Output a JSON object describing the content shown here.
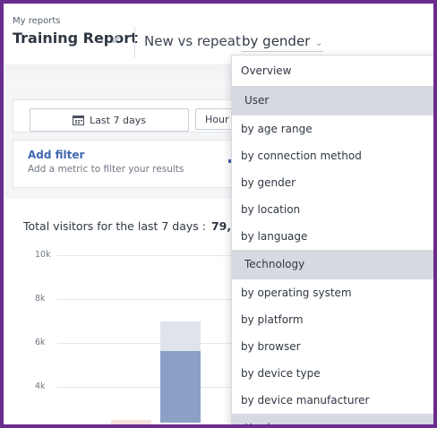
{
  "header": {
    "breadcrumb": "My reports",
    "title": "Training Report",
    "subtitle": "New vs repeat",
    "selector_value": "by gender",
    "selector_chevron": "⌄"
  },
  "controls": {
    "date_label": "Last 7 days",
    "interval_label": "Hour"
  },
  "filter": {
    "title": "Add filter",
    "description": "Add a metric to filter your results"
  },
  "chart_data": {
    "type": "bar",
    "title": "Total visitors for the last 7 days :",
    "total_prefix": "79,",
    "yticks": [
      "10k",
      "8k",
      "6k",
      "4k"
    ],
    "ylim": [
      2000,
      10000
    ],
    "series": [
      {
        "values": [
          7000
        ],
        "color": "#dfe4ec"
      },
      {
        "values": [
          5650
        ],
        "color": "#8aa1c5"
      }
    ],
    "partial_bar_color": "#f8e1dc"
  },
  "dropdown": {
    "items": [
      {
        "kind": "item",
        "label": "Overview"
      },
      {
        "kind": "group",
        "label": "User"
      },
      {
        "kind": "item",
        "label": "by age range"
      },
      {
        "kind": "item",
        "label": "by connection method"
      },
      {
        "kind": "item",
        "label": "by gender"
      },
      {
        "kind": "item",
        "label": "by location"
      },
      {
        "kind": "item",
        "label": "by language"
      },
      {
        "kind": "group",
        "label": "Technology"
      },
      {
        "kind": "item",
        "label": "by operating system"
      },
      {
        "kind": "item",
        "label": "by platform"
      },
      {
        "kind": "item",
        "label": "by browser"
      },
      {
        "kind": "item",
        "label": "by device type"
      },
      {
        "kind": "item",
        "label": "by device manufacturer"
      },
      {
        "kind": "group",
        "label": "Hardware"
      }
    ]
  }
}
